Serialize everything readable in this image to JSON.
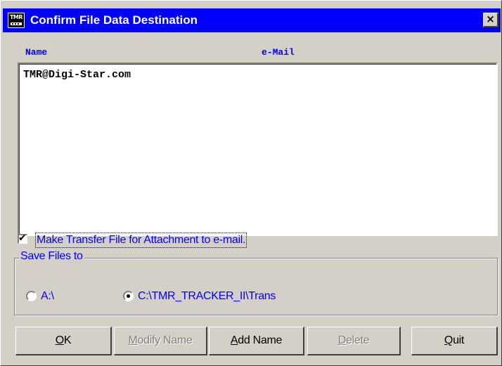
{
  "window": {
    "title": "Confirm File Data Destination",
    "app_icon_text": "TMR",
    "close_glyph": "×"
  },
  "list": {
    "columns": [
      "Name",
      "e-Mail"
    ],
    "items": [
      "TMR@Digi-Star.com"
    ]
  },
  "attachment_checkbox": {
    "label": "Make Transfer File for Attachment to e-mail.",
    "checked": true,
    "check_glyph": "✔"
  },
  "save_group": {
    "title": "Save Files to",
    "options": [
      {
        "label": "A:\\",
        "selected": false
      },
      {
        "label": "C:\\TMR_TRACKER_II\\Trans",
        "selected": true
      }
    ]
  },
  "buttons": {
    "ok": {
      "first": "O",
      "rest": "K",
      "enabled": true
    },
    "modify": {
      "first": "M",
      "rest": "odify Name",
      "enabled": false
    },
    "add": {
      "first": "A",
      "rest": "dd Name",
      "enabled": true
    },
    "delete": {
      "first": "D",
      "rest": "elete",
      "enabled": false
    },
    "quit": {
      "first": "Q",
      "rest": "uit",
      "enabled": true
    }
  },
  "colors": {
    "titlebar": "#0000ff",
    "label_text": "#0000ff",
    "dialog_face": "#d4d0c8"
  }
}
